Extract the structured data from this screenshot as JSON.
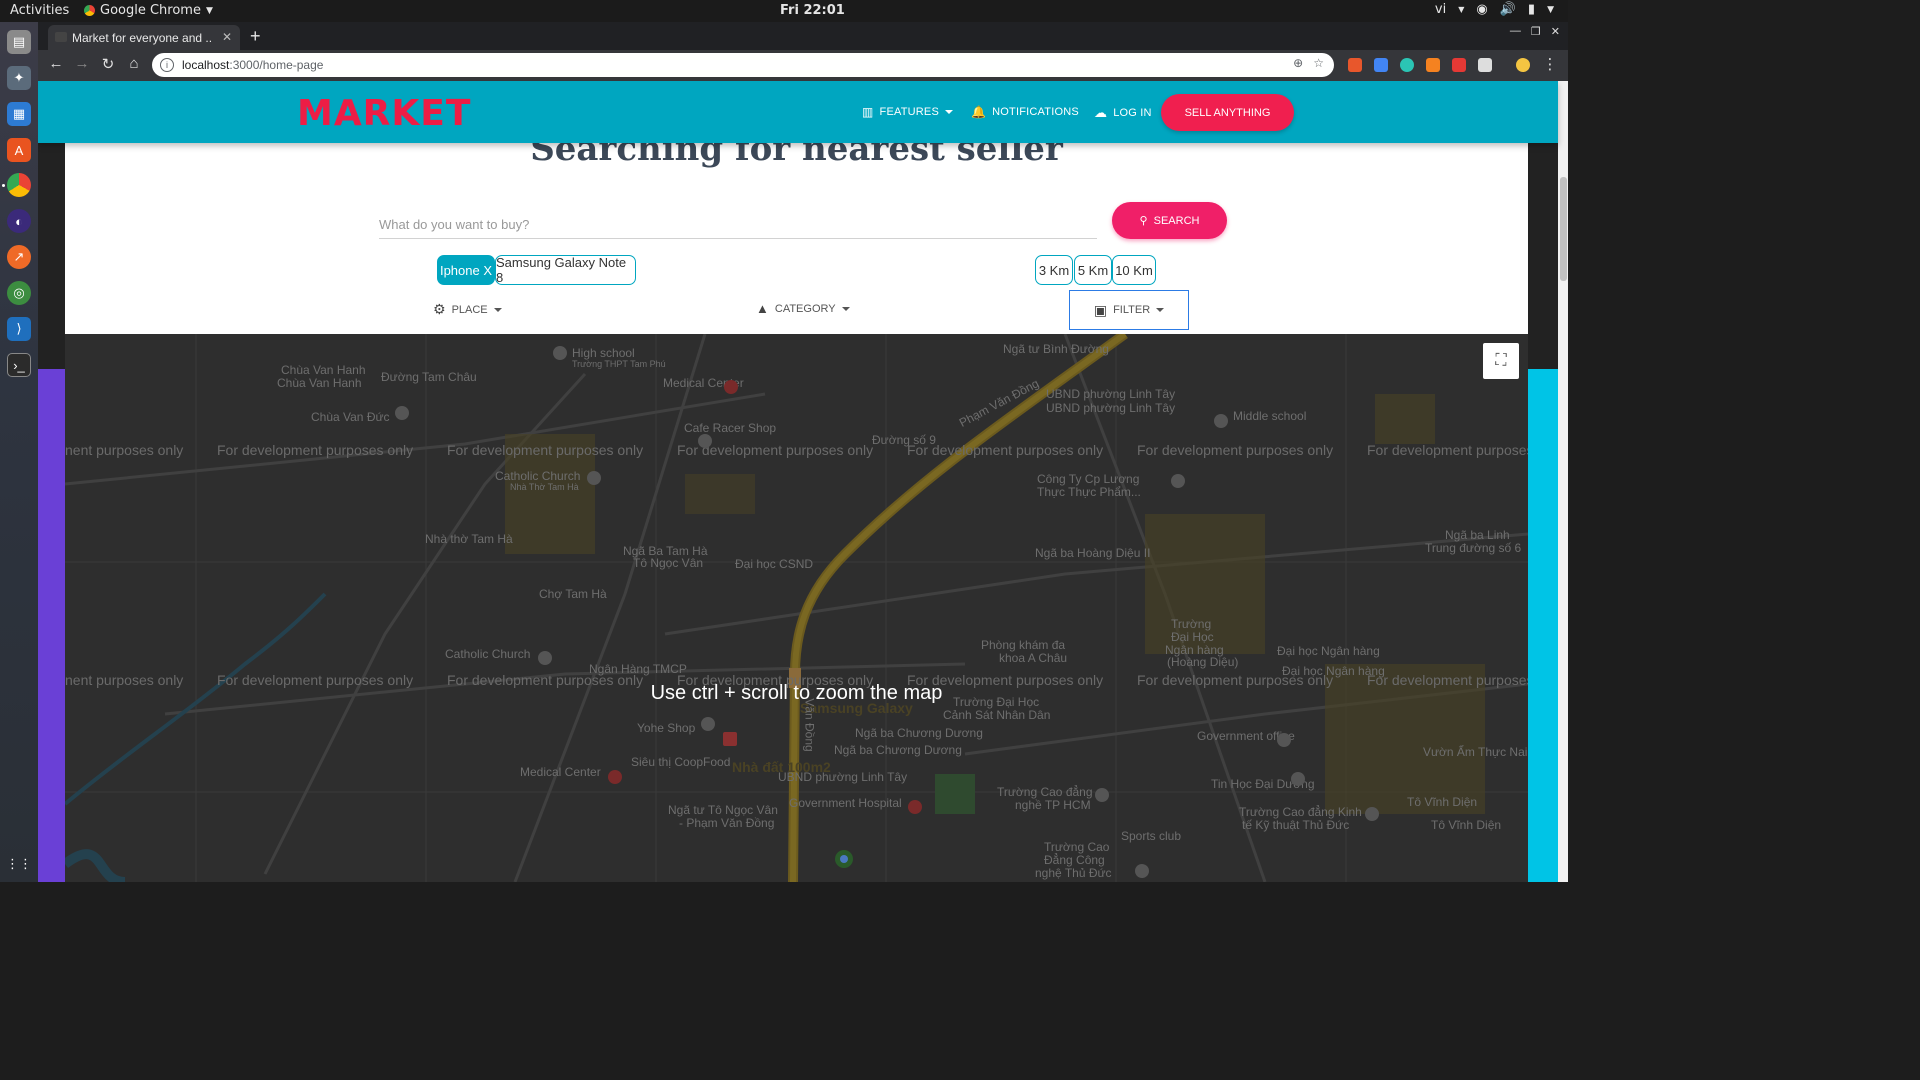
{
  "os": {
    "activities": "Activities",
    "app_name": "Google Chrome",
    "clock": "Fri 22:01",
    "lang": "vi"
  },
  "browser": {
    "tab_title": "Market for everyone and ...",
    "url_host": "localhost",
    "url_path": ":3000/home-page"
  },
  "navbar": {
    "brand": "MARKET",
    "features": "FEATURES",
    "notifications": "NOTIFICATIONS",
    "login": "LOG IN",
    "sell": "SELL ANYTHING"
  },
  "search": {
    "title": "Searching for nearest seller",
    "placeholder": "What do you want to buy?",
    "button": "SEARCH",
    "product_chips": [
      "Iphone X",
      "Samsung Galaxy Note 8"
    ],
    "distance_chips": [
      "3 Km",
      "5 Km",
      "10 Km"
    ],
    "place": "PLACE",
    "category": "CATEGORY",
    "filter": "FILTER"
  },
  "map": {
    "zoom_message": "Use ctrl + scroll to zoom the map",
    "dev_text": "For development purposes only",
    "dev_text_left": "nent purposes only",
    "dev_text_right": "For development purposes",
    "labels": {
      "a1": "Chùa Van Hanh",
      "a2": "Chùa Van Hanh",
      "a3": "Đường Tam Châu",
      "a4": "High school",
      "a5": "Trường THPT Tam Phú",
      "a6": "Medical Center",
      "a7": "Ngã tư Bình Đường",
      "a8": "UBND phường Linh Tây",
      "a9": "UBND phường Linh Tây",
      "a10": "Middle school",
      "a11": "Chùa Van Đức",
      "a12": "Cafe Racer Shop",
      "a13": "Đường số 9",
      "a14": "Phạm Văn Đồng",
      "a15": "Catholic Church",
      "a16": "Nhà Thờ Tam Hà",
      "a17": "Công Ty Cp Lương",
      "a18": "Thực Thực Phẩm...",
      "a19": "Nhà thờ Tam Hà",
      "a20": "Ngã Ba Tam Hà",
      "a21": "Tô Ngọc Vân",
      "a22": "Đại học CSND",
      "a23": "Ngã ba Hoàng Diệu II",
      "a24": "Ngã ba Linh",
      "a25": "Trung đường số 6",
      "a26": "Chợ Tam Hà",
      "a27": "Phòng khám đa",
      "a28": "khoa A Châu",
      "a29": "Trường",
      "a30": "Đại Học",
      "a31": "Ngân hàng",
      "a32": "(Hoàng Diệu)",
      "a33": "Đại học Ngân hàng",
      "a34": "Đại học Ngân hàng",
      "a35": "Catholic Church",
      "a36": "Ngân Hàng TMCP",
      "a37": "Trường Đại Học",
      "a38": "Cảnh Sát Nhân Dân",
      "a39": "Yohe Shop",
      "a40": "Ngã ba Chương Dương",
      "a41": "Ngã ba Chương Dương",
      "a42": "Government office",
      "a43": "Vườn Ẩm Thực Nai Vàng",
      "a44": "Siêu thị CoopFood",
      "a45": "Nhà đất 100m2",
      "a46": "UBND phường Linh Tây",
      "a47": "Tin Học Đại Dương",
      "a48": "Medical Center",
      "a49": "Trường Cao đẳng",
      "a50": "nghề TP HCM",
      "a51": "Trường Cao đẳng Kinh",
      "a52": "tế Kỹ thuật Thủ Đức",
      "a53": "Tô Vĩnh Diện",
      "a54": "Tô Vĩnh Diện",
      "a55": "Ngã tư Tô Ngọc Vân",
      "a56": "- Phạm Văn Đồng",
      "a57": "Government Hospital",
      "a58": "Sports club",
      "a59": "Trường Cao",
      "a60": "Đẳng Công",
      "a61": "nghệ Thủ Đức",
      "a62": "Samsung Galaxy",
      "a63": "Văn Đồng"
    }
  },
  "colors": {
    "navbar": "#00a6c0",
    "brand": "#ed1d45",
    "sell": "#f01f4f",
    "search": "#f01f68"
  }
}
